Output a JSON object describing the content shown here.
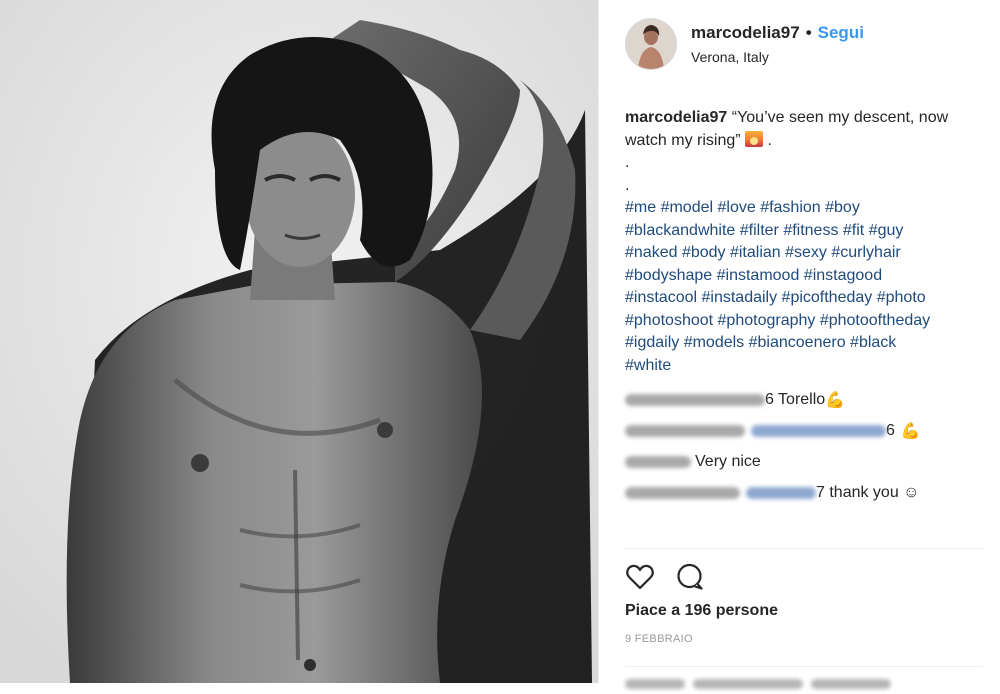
{
  "post": {
    "username": "marcodelia97",
    "separator": "•",
    "follow_label": "Segui",
    "location": "Verona, Italy",
    "caption": {
      "username": "marcodelia97",
      "text": "“You’ve seen my descent, now watch my rising”",
      "emoji_name": "sunset-emoji",
      "after_emoji": " .",
      "dot1": ".",
      "dot2": "."
    },
    "hashtag_lines": [
      "#me #model #love #fashion #boy",
      "#blackandwhite #filter #fitness #fit #guy",
      "#naked #body #italian #sexy #curlyhair",
      "#bodyshape #instamood #instagood",
      "#instacool #instadaily #picoftheday #photo",
      "#photoshoot #photography #photooftheday",
      "#igdaily #models #biancoenero #black",
      "#white"
    ],
    "comments": [
      {
        "visible_text": "6 Torello",
        "emoji": "💪"
      },
      {
        "visible_text": "6",
        "emoji": "💪"
      },
      {
        "visible_text": "Very nice",
        "emoji": ""
      },
      {
        "visible_text": "7 thank you ☺",
        "emoji": ""
      }
    ],
    "likes_text": "Piace a 196 persone",
    "date_text": "9 FEBBRAIO",
    "icons": {
      "like": "heart-icon",
      "comment": "comment-bubble-icon"
    },
    "colors": {
      "link": "#3897f0",
      "hashtag": "#1f4b7c",
      "muted": "#999999",
      "text": "#262626"
    }
  }
}
